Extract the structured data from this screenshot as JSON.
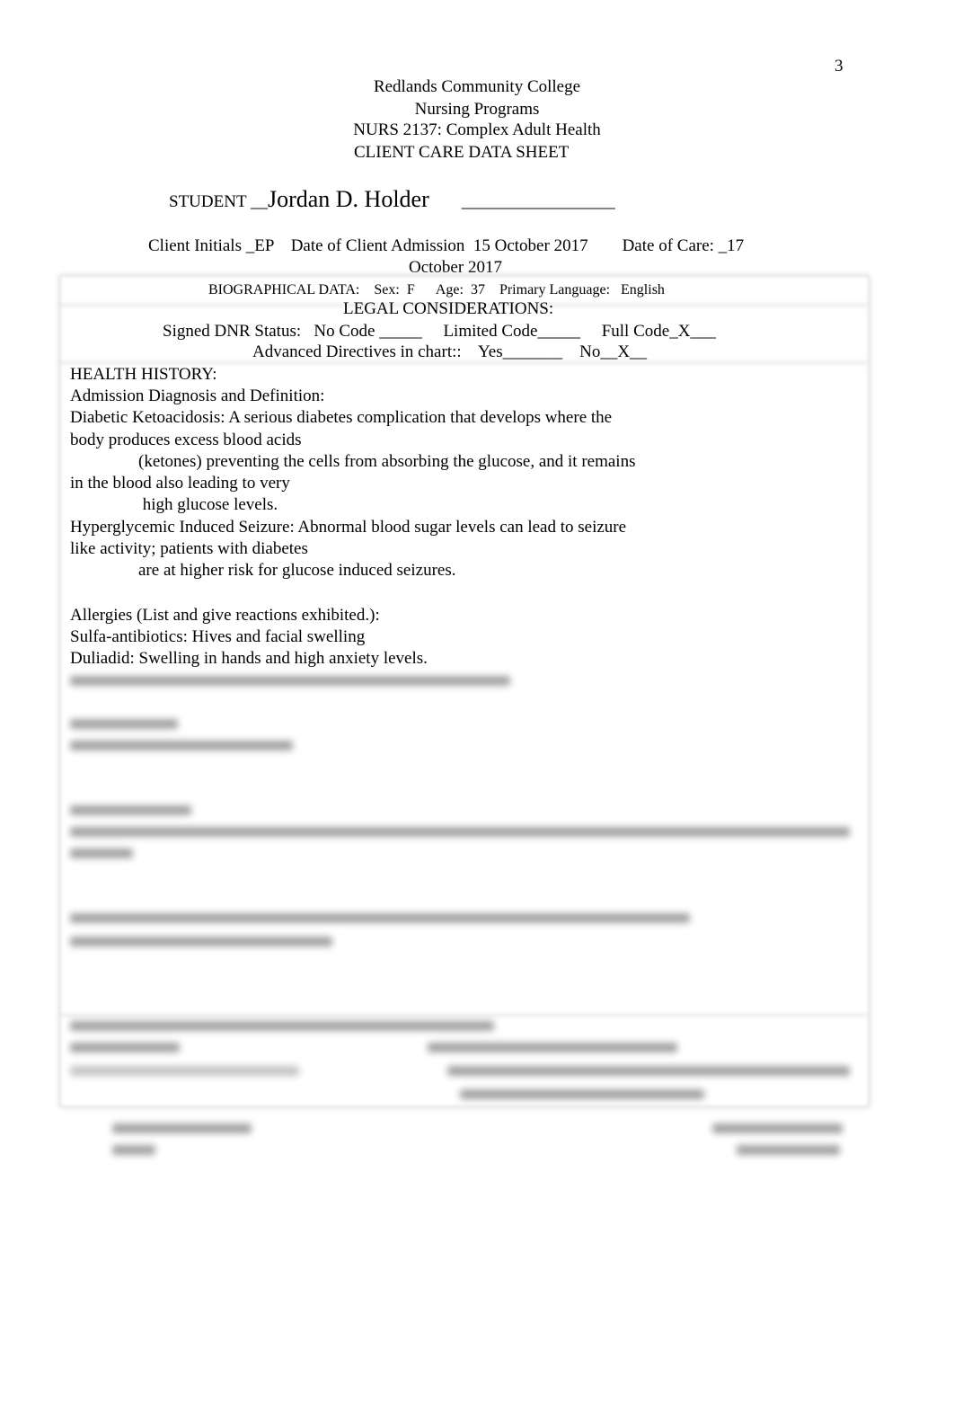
{
  "page_number": "3",
  "header": {
    "institution": "Redlands Community College",
    "program": "Nursing Programs",
    "course": "NURS 2137: Complex Adult Health",
    "sheet_title": "CLIENT CARE DATA SHEET"
  },
  "student": {
    "label": "STUDENT __",
    "name": "Jordan D. Holder",
    "trailing_blank": "__________________"
  },
  "client": {
    "initials_label": "Client Initials _EP",
    "admission_label": "Date of Client Admission",
    "admission_date": "15 October 2017",
    "care_label": "Date of Care: _17",
    "care_date_cont": "October 2017"
  },
  "biographical": {
    "label": "BIOGRAPHICAL DATA:",
    "sex_label": "Sex:",
    "sex": "F",
    "age_label": "Age:",
    "age": "37",
    "language_label": "Primary Language:",
    "language": "English"
  },
  "legal": {
    "title": "LEGAL CONSIDERATIONS:",
    "dnr_line": "Signed DNR Status:   No Code _____     Limited Code_____     Full Code_X___",
    "advance_line": "Advanced Directives in chart::    Yes_______    No__X__"
  },
  "health_history": {
    "title": "HEALTH HISTORY:",
    "diagnosis_label": "Admission Diagnosis and Definition:",
    "diagnosis_lines": [
      "Diabetic Ketoacidosis: A serious diabetes complication that develops where the",
      "body produces excess blood acids",
      "                (ketones) preventing the cells from absorbing the glucose, and it remains",
      "in the blood also leading to very",
      "                 high glucose levels.",
      "Hyperglycemic Induced Seizure: Abnormal blood sugar levels can lead to seizure",
      "like activity; patients with diabetes",
      "                are at higher risk for glucose induced seizures."
    ],
    "allergies_label": "Allergies (List and give reactions exhibited.):",
    "allergies": [
      "Sulfa-antibiotics: Hives and facial swelling",
      "Duliadid: Swelling in hands and high anxiety levels."
    ]
  }
}
